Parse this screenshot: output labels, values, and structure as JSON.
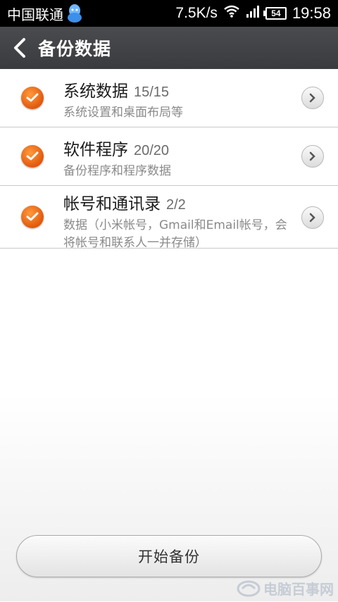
{
  "status_bar": {
    "carrier": "中国联通",
    "speed": "7.5K/s",
    "battery": "54",
    "time": "19:58"
  },
  "header": {
    "title": "备份数据"
  },
  "items": [
    {
      "title": "系统数据",
      "count": "15/15",
      "subtitle": "系统设置和桌面布局等",
      "checked": true
    },
    {
      "title": "软件程序",
      "count": "20/20",
      "subtitle": "备份程序和程序数据",
      "checked": true
    },
    {
      "title": "帐号和通讯录",
      "count": "2/2",
      "subtitle": "数据（小米帐号，Gmail和Email帐号，会将帐号和联系人一并存储）",
      "checked": true
    }
  ],
  "start_button": {
    "label": "开始备份"
  },
  "watermark": {
    "text": "电脑百事网"
  },
  "colors": {
    "accent": "#f07a1f",
    "titlebar": "#424346"
  }
}
